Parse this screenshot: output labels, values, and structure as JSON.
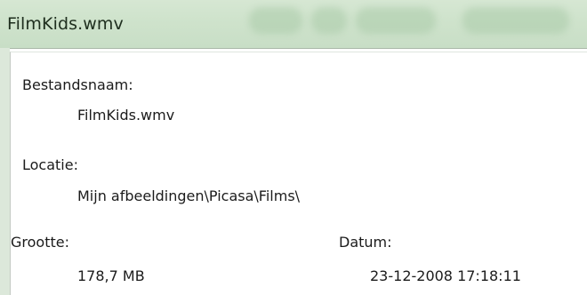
{
  "window": {
    "title": "FilmKids.wmv"
  },
  "properties": {
    "filename_label": "Bestandsnaam:",
    "filename_value": "FilmKids.wmv",
    "location_label": "Locatie:",
    "location_value": "Mijn afbeeldingen\\Picasa\\Films\\",
    "size_label": "Grootte:",
    "size_value": "178,7 MB",
    "date_label": "Datum:",
    "date_value": "23-12-2008 17:18:11"
  },
  "colors": {
    "titlebar": "#d6e7d3",
    "text": "#1b1b1b"
  }
}
